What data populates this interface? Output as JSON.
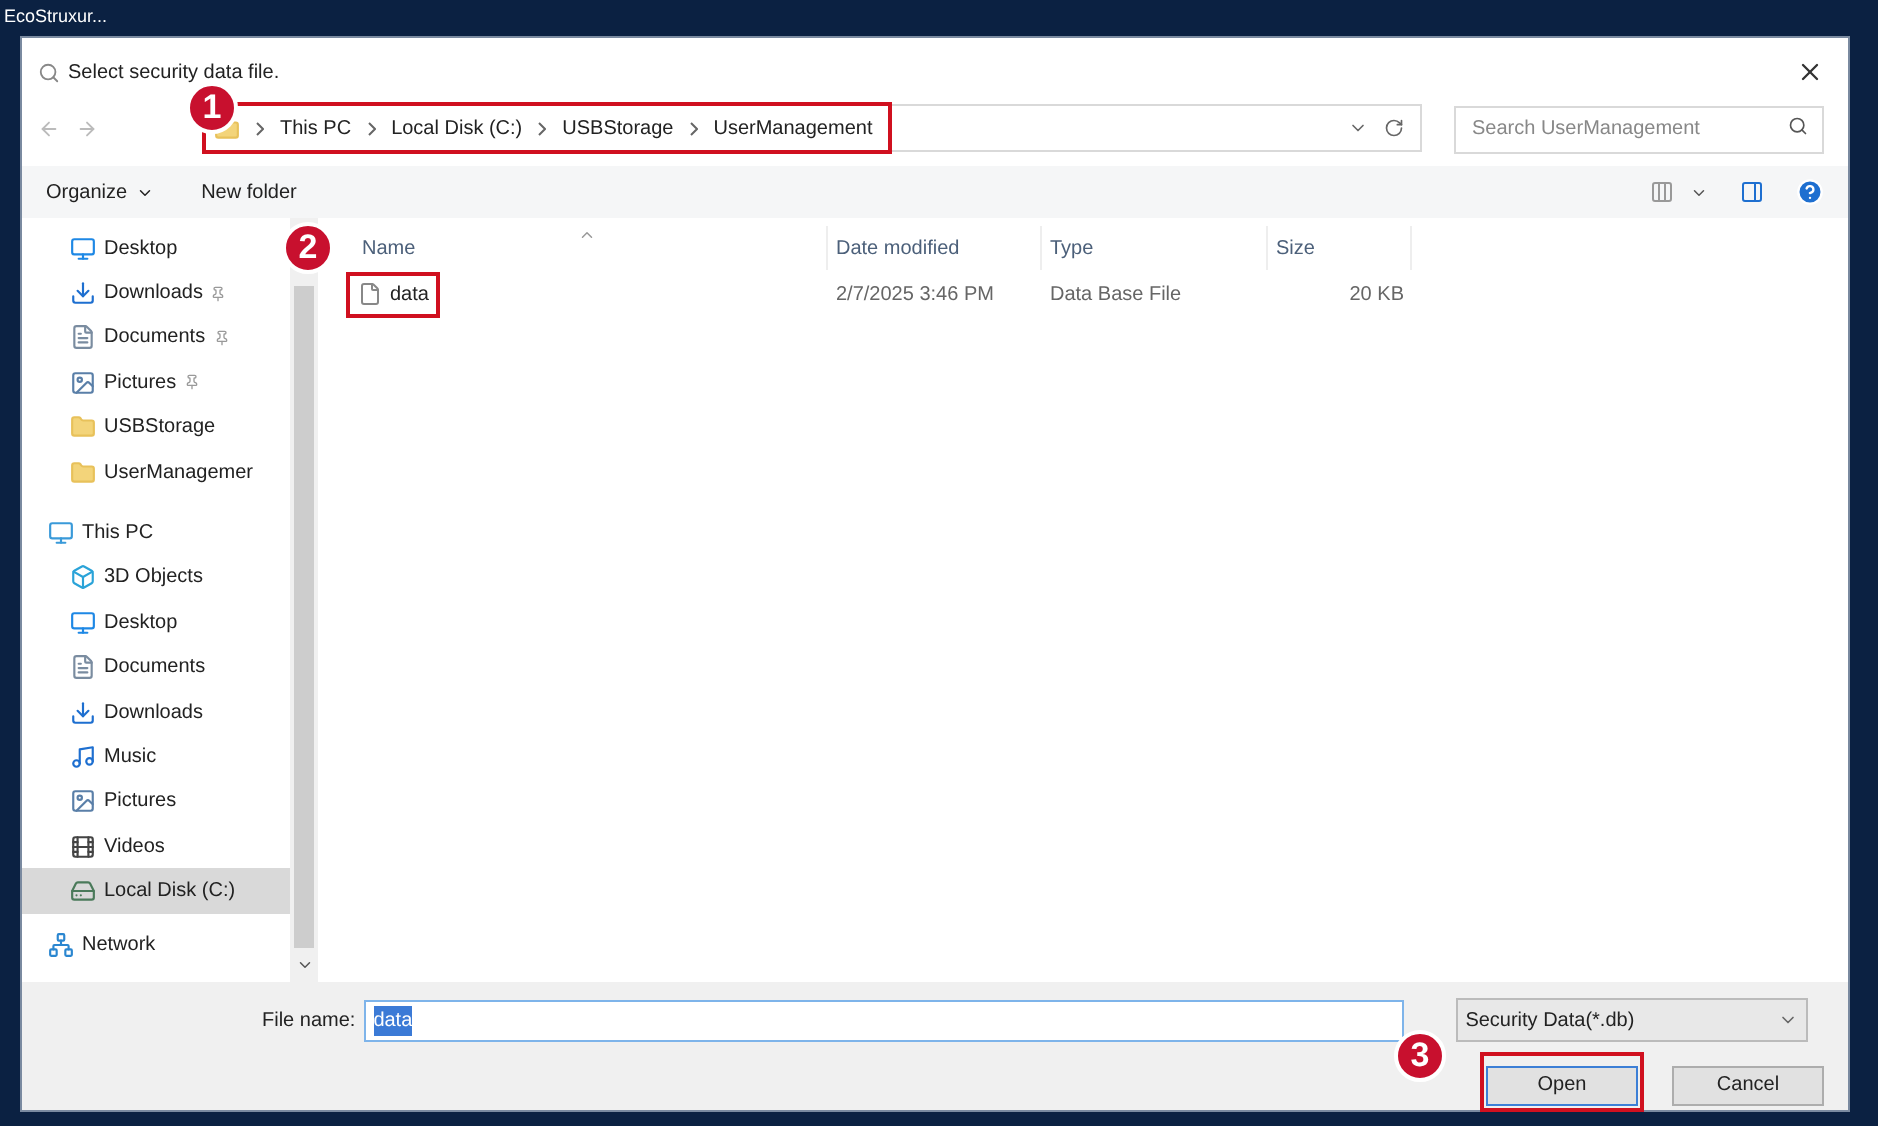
{
  "app_title": "EcoStruxur...",
  "dialog": {
    "title": "Select security data file."
  },
  "address": {
    "path": [
      "This PC",
      "Local Disk (C:)",
      "USBStorage",
      "UserManagement"
    ],
    "highlighted": true,
    "badge": "1"
  },
  "search": {
    "placeholder": "Search UserManagement"
  },
  "toolbar": {
    "organize": "Organize",
    "new_folder": "New folder"
  },
  "nav": [
    {
      "label": "Desktop",
      "kind": "desktop",
      "pinned": false,
      "selected": false
    },
    {
      "label": "Downloads",
      "kind": "downloads",
      "pinned": true,
      "selected": false
    },
    {
      "label": "Documents",
      "kind": "documents",
      "pinned": true,
      "selected": false
    },
    {
      "label": "Pictures",
      "kind": "pictures",
      "pinned": true,
      "selected": false
    },
    {
      "label": "USBStorage",
      "kind": "folder",
      "pinned": false,
      "selected": false
    },
    {
      "label": "UserManagemer",
      "kind": "folder",
      "pinned": false,
      "selected": false
    },
    {
      "label": "This PC",
      "kind": "pc",
      "selected": false,
      "children": [
        {
          "label": "3D Objects",
          "kind": "objects",
          "selected": false
        },
        {
          "label": "Desktop",
          "kind": "desktop",
          "selected": false
        },
        {
          "label": "Documents",
          "kind": "documents",
          "selected": false
        },
        {
          "label": "Downloads",
          "kind": "downloads",
          "selected": false
        },
        {
          "label": "Music",
          "kind": "music",
          "selected": false
        },
        {
          "label": "Pictures",
          "kind": "pictures",
          "selected": false
        },
        {
          "label": "Videos",
          "kind": "videos",
          "selected": false
        },
        {
          "label": "Local Disk (C:)",
          "kind": "disk",
          "selected": true
        }
      ]
    },
    {
      "label": "Network",
      "kind": "network",
      "selected": false
    }
  ],
  "columns": [
    "Name",
    "Date modified",
    "Type",
    "Size"
  ],
  "files": [
    {
      "name": "data",
      "date": "2/7/2025 3:46 PM",
      "type": "Data Base File",
      "size": "20 KB",
      "highlighted": true,
      "badge": "2"
    }
  ],
  "file_name": {
    "label": "File name:",
    "value": "data",
    "text_selected": true
  },
  "filter": "Security Data(*.db)",
  "buttons": [
    {
      "label": "Open",
      "default": true,
      "highlighted": true,
      "badge": "3"
    },
    {
      "label": "Cancel",
      "default": false,
      "highlighted": false
    }
  ]
}
